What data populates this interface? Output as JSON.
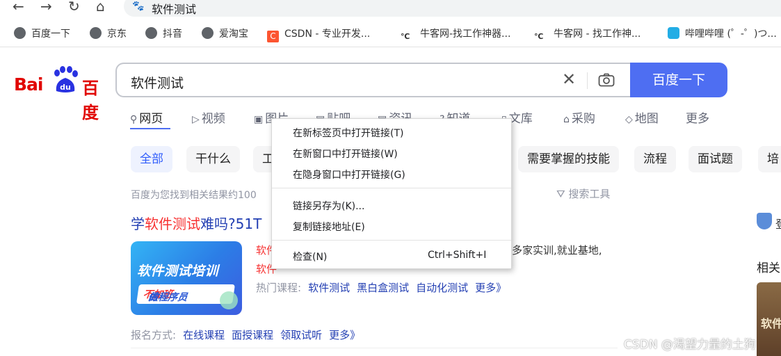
{
  "browser": {
    "nav": {
      "back": "←",
      "forward": "→",
      "reload": "↻",
      "home": "⌂"
    },
    "url_text": "软件测试",
    "bookmarks": [
      "百度一下",
      "京东",
      "抖音",
      "爱淘宝",
      "CSDN - 专业开发...",
      "牛客网-找工作神器...",
      "牛客网 - 找工作神...",
      "哔哩哔哩 (゜-゜)つ..."
    ]
  },
  "baidu": {
    "logo": {
      "bai": "Bai",
      "du_icon": "du",
      "cn": "百度"
    },
    "search": {
      "query": "软件测试",
      "clear": "✕",
      "button": "百度一下"
    },
    "tabs": [
      {
        "label": "网页",
        "icon": "search-icon"
      },
      {
        "label": "视频",
        "icon": "video-icon"
      },
      {
        "label": "图片",
        "icon": "image-icon"
      },
      {
        "label": "贴吧",
        "icon": "tieba-icon"
      },
      {
        "label": "资讯",
        "icon": "news-icon"
      },
      {
        "label": "知道",
        "icon": "zhidao-icon"
      },
      {
        "label": "文库",
        "icon": "wenku-icon"
      },
      {
        "label": "采购",
        "icon": "purchase-icon"
      },
      {
        "label": "地图",
        "icon": "map-icon"
      },
      {
        "label": "更多",
        "icon": ""
      }
    ],
    "chips": [
      "全部",
      "干什么",
      "工",
      "需要掌握的技能",
      "流程",
      "面试题",
      "培"
    ],
    "result_info": "百度为您找到相关结果约100",
    "search_tools": "搜索工具",
    "result": {
      "title_pre": "学",
      "title_em": "软件测试",
      "title_post": "难吗?51T",
      "thumb_line1": "软件测试培训",
      "thumb_line2_pre": "做",
      "thumb_line2_em": "不加班",
      "thumb_line2_post": "的程序员",
      "snippet1_em": "软件",
      "snippet1_rest": "多家实训,就业基地,",
      "snippet2_em": "软件",
      "hot_label": "热门课程:",
      "hot_links": [
        "软件测试",
        "黑白盒测试",
        "自动化测试",
        "更多》"
      ],
      "sign_label": "报名方式:",
      "sign_links": [
        "在线课程",
        "面授课程",
        "领取试听",
        "更多》"
      ]
    },
    "right": {
      "side_text": "登",
      "related": "相关",
      "book_text": "软件"
    }
  },
  "context_menu": {
    "items": [
      {
        "label": "在新标签页中打开链接(T)"
      },
      {
        "label": "在新窗口中打开链接(W)"
      },
      {
        "label": "在隐身窗口中打开链接(G)"
      },
      {
        "label": "链接另存为(K)..."
      },
      {
        "label": "复制链接地址(E)"
      },
      {
        "label": "检查(N)",
        "shortcut": "Ctrl+Shift+I"
      }
    ]
  },
  "watermark": "CSDN @渴望力量的土狗"
}
